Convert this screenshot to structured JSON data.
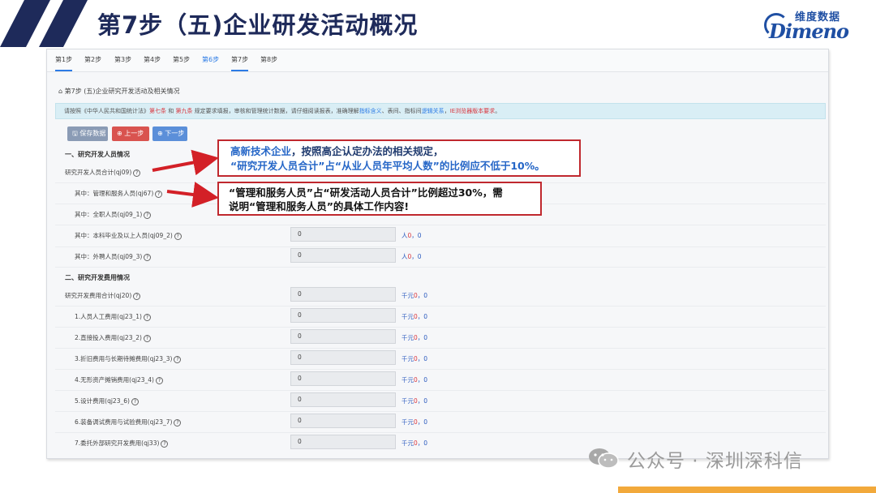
{
  "slide": {
    "title": "第7步（五)企业研发活动概况",
    "logo_cn": "维度数据",
    "logo_en": "Dimeno"
  },
  "steps": [
    "第1步",
    "第2步",
    "第3步",
    "第4步",
    "第5步",
    "第6步",
    "第7步",
    "第8步"
  ],
  "breadcrumb": "第7步 (五)企业研究开发活动及相关情况",
  "notice": {
    "part1": "请按照《中华人民共和国统计法》",
    "red1": "第七条",
    "part2": " 和 ",
    "red2": "第九条",
    "part3": " 规定要求填报，审核和管理统计数据，请仔细阅读报表，准确理解",
    "blue1": "指标含义",
    "part4": "、表间、指标间",
    "blue2": "逻辑关系",
    "part5": "，",
    "red3": "IE浏览器版本要求",
    "part6": "。"
  },
  "buttons": {
    "save": "保存数据",
    "prev": "上一步",
    "next": "下一步"
  },
  "section1": "一、研究开发人员情况",
  "section2": "二、研究开发费用情况",
  "personnel_rows": [
    {
      "label": "研究开发人员合计(qj09)",
      "value": "",
      "unit": ""
    },
    {
      "label": "其中：管理和服务人员(qj67)",
      "value": "",
      "unit": ""
    },
    {
      "label": "其中：全职人员(qj09_1)",
      "value": "",
      "unit": ""
    },
    {
      "label": "其中：本科毕业及以上人员(qj09_2)",
      "value": "0",
      "unit": "人",
      "extra1": "0",
      "extra2": "0"
    },
    {
      "label": "其中：外聘人员(qj09_3)",
      "value": "0",
      "unit": "人",
      "extra1": "0",
      "extra2": "0"
    }
  ],
  "expense_rows": [
    {
      "label": "研究开发费用合计(qj20)",
      "value": "0",
      "unit": "千元",
      "extra1": "0",
      "extra2": "0"
    },
    {
      "label": "1.人员人工费用(qj23_1)",
      "value": "0",
      "unit": "千元",
      "extra1": "0",
      "extra2": "0"
    },
    {
      "label": "2.直接投入费用(qj23_2)",
      "value": "0",
      "unit": "千元",
      "extra1": "0",
      "extra2": "0"
    },
    {
      "label": "3.折旧费用与长期待摊费用(qj23_3)",
      "value": "0",
      "unit": "千元",
      "extra1": "0",
      "extra2": "0"
    },
    {
      "label": "4.无形资产摊销费用(qj23_4)",
      "value": "0",
      "unit": "千元",
      "extra1": "0",
      "extra2": "0"
    },
    {
      "label": "5.设计费用(qj23_6)",
      "value": "0",
      "unit": "千元",
      "extra1": "0",
      "extra2": "0"
    },
    {
      "label": "6.装备调试费用与试验费用(qj23_7)",
      "value": "0",
      "unit": "千元",
      "extra1": "0",
      "extra2": "0"
    },
    {
      "label": "7.委托外部研究开发费用(qj33)",
      "value": "0",
      "unit": "千元",
      "extra1": "0",
      "extra2": "0"
    }
  ],
  "callout1": {
    "highlight": "高新技术企业",
    "line1_rest": "，按照高企认定办法的相关规定，",
    "line2": "“研究开发人员合计”占“从业人员年平均人数”的比例应不低于10%。"
  },
  "callout2": {
    "line1": "“管理和服务人员”占“研发活动人员合计”比例超过30%，需",
    "line2": "说明“管理和服务人员”的具体工作内容!"
  },
  "watermark": "公众号 · 深圳深科信",
  "colors": {
    "title": "#1e2a5a",
    "accent_blue": "#2c7be5",
    "callout_border": "#c0282e",
    "footer_bar": "#f2a93b"
  }
}
